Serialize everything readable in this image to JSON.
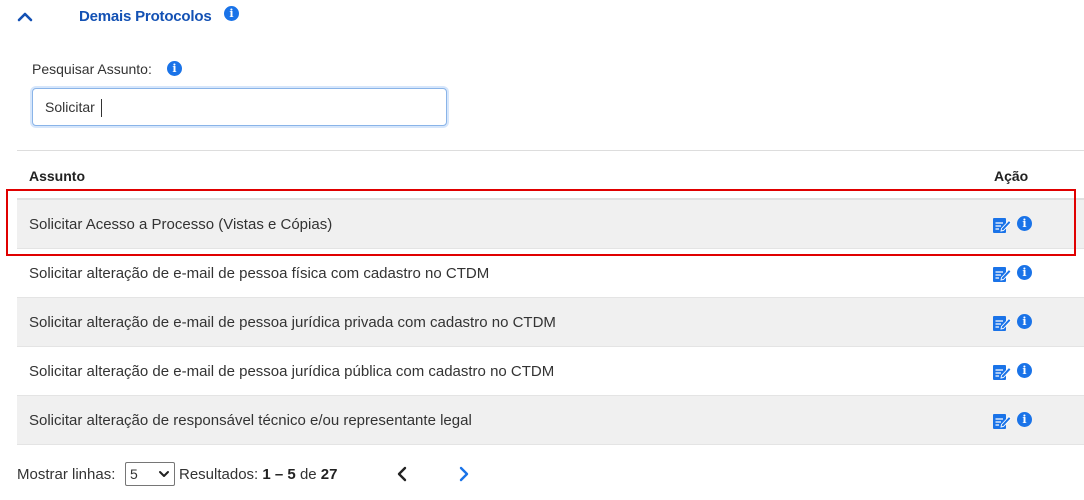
{
  "section": {
    "title": "Demais Protocolos",
    "info_icon": "info-icon"
  },
  "search": {
    "label": "Pesquisar Assunto:",
    "value": "Solicitar"
  },
  "table": {
    "headers": {
      "subject": "Assunto",
      "action": "Ação"
    },
    "rows": [
      {
        "subject": "Solicitar Acesso a Processo (Vistas e Cópias)",
        "highlighted": true
      },
      {
        "subject": "Solicitar alteração de e-mail de pessoa física com cadastro no CTDM"
      },
      {
        "subject": "Solicitar alteração de e-mail de pessoa jurídica privada com cadastro no CTDM"
      },
      {
        "subject": "Solicitar alteração de e-mail de pessoa jurídica pública com cadastro no CTDM"
      },
      {
        "subject": "Solicitar alteração de responsável técnico e/ou representante legal"
      }
    ],
    "row_actions": [
      "edit-form-icon",
      "info-icon"
    ]
  },
  "pagination": {
    "rows_label": "Mostrar linhas:",
    "rows_per_page": "5",
    "results_label": "Resultados:",
    "range": "1 – 5",
    "of_label": "de",
    "total": "27"
  },
  "colors": {
    "primary": "#1351b4",
    "info_icon": "#1a73e8",
    "highlight_border": "#e00000",
    "striped_row": "#f0f0f0"
  }
}
